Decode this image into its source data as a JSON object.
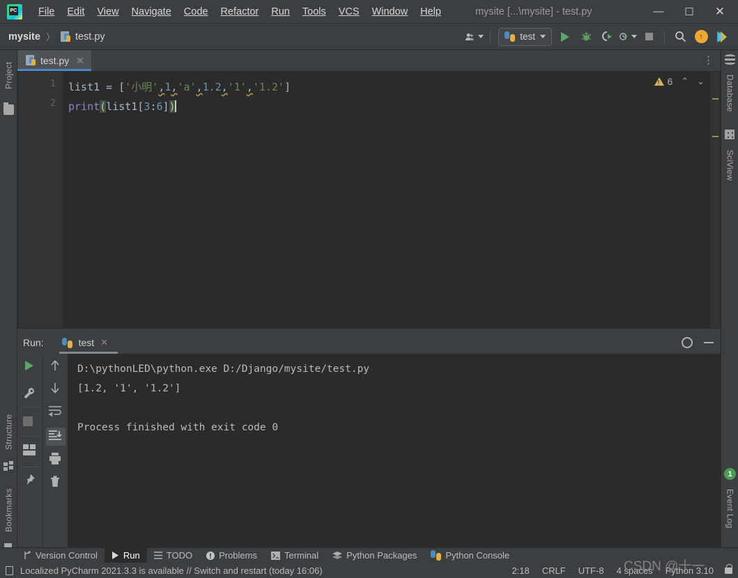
{
  "titlebar": {
    "logo": "pycharm-logo",
    "logo_text": "PC",
    "menus": [
      "File",
      "Edit",
      "View",
      "Navigate",
      "Code",
      "Refactor",
      "Run",
      "Tools",
      "VCS",
      "Window",
      "Help"
    ],
    "window_title": "mysite [...\\mysite] - test.py",
    "minimize": "—",
    "maximize": "☐",
    "close": "✕"
  },
  "navbar": {
    "project": "mysite",
    "separator": "〉",
    "file": "test.py",
    "run_config": "test",
    "icons": [
      "user-dropdown-icon",
      "run-icon",
      "debug-icon",
      "coverage-icon",
      "profile-icon",
      "stop-icon",
      "search-icon",
      "update-icon",
      "ai-assistant-icon"
    ]
  },
  "left_stripe": {
    "project": "Project",
    "structure": "Structure",
    "bookmarks": "Bookmarks"
  },
  "right_stripe": {
    "database": "Database",
    "sciview": "SciView",
    "event_log": "Event Log",
    "event_log_badge": "1"
  },
  "editor": {
    "tab_name": "test.py",
    "tab_close": "✕",
    "tab_menu": "⋮",
    "warning_count": "6",
    "chevron_up": "⌃",
    "chevron_down": "⌄",
    "line_numbers": [
      "1",
      "2"
    ],
    "code": {
      "line1": {
        "var": "list1",
        "eq": " = ",
        "open_bracket": "[",
        "s1": "'小明'",
        "c1": ",",
        "n1": "1",
        "c2": ",",
        "s2": "'a'",
        "c3": ",",
        "n2": "1.2",
        "c4": ",",
        "s3": "'1'",
        "c5": ",",
        "s4": "'1.2'",
        "close_bracket": "]"
      },
      "line2": {
        "fn": "print",
        "lparen": "(",
        "arg_var": "list1",
        "lbrack": "[",
        "slice_a": "3",
        "colon": ":",
        "slice_b": "6",
        "rbrack": "]",
        "rparen": ")"
      }
    }
  },
  "run_window": {
    "label": "Run:",
    "tab_name": "test",
    "tab_close": "✕",
    "settings_icon": "gear-icon",
    "hide_icon": "minimize-icon",
    "left_icons": [
      "rerun-icon",
      "settings-wrench-icon",
      "stop-icon",
      "layout-icon",
      "pin-icon"
    ],
    "mid_icons": [
      "up-arrow-icon",
      "down-arrow-icon",
      "soft-wrap-icon",
      "scroll-to-end-icon",
      "print-icon",
      "delete-icon"
    ],
    "console": [
      "D:\\pythonLED\\python.exe D:/Django/mysite/test.py",
      "[1.2, '1', '1.2']",
      "",
      "Process finished with exit code 0"
    ]
  },
  "bottom_tabs": [
    {
      "label": "Version Control",
      "icon": "branch-icon",
      "active": false
    },
    {
      "label": "Run",
      "icon": "play-icon",
      "active": true
    },
    {
      "label": "TODO",
      "icon": "list-icon",
      "active": false
    },
    {
      "label": "Problems",
      "icon": "warning-circle-icon",
      "active": false
    },
    {
      "label": "Terminal",
      "icon": "terminal-icon",
      "active": false
    },
    {
      "label": "Python Packages",
      "icon": "packages-icon",
      "active": false
    },
    {
      "label": "Python Console",
      "icon": "python-icon",
      "active": false
    }
  ],
  "statusbar": {
    "message": "Localized PyCharm 2021.3.3 is available // Switch and restart (today 16:06)",
    "caret_position": "2:18",
    "line_separator": "CRLF",
    "encoding": "UTF-8",
    "indent": "4 spaces",
    "interpreter": "Python 3.10"
  },
  "watermark": "CSDN @十一"
}
